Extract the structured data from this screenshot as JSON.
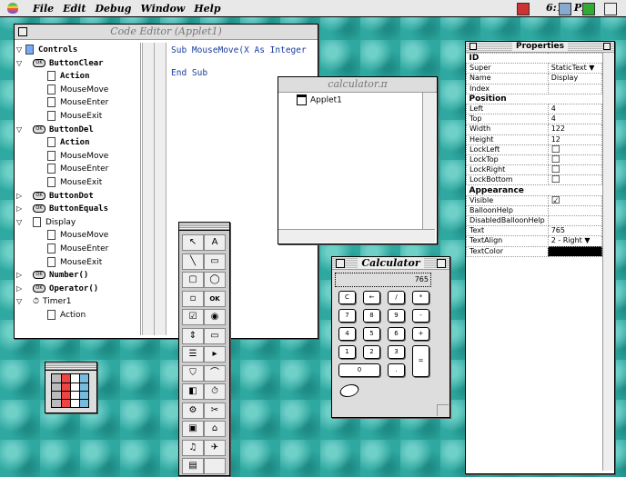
{
  "menubar": {
    "items": [
      "File",
      "Edit",
      "Debug",
      "Window",
      "Help"
    ],
    "clock": "6:15 PM"
  },
  "code_editor": {
    "title": "Code Editor (Applet1)",
    "code_lines": [
      "Sub MouseMove(X As Integer",
      "End Sub"
    ],
    "tree": [
      {
        "label": "Controls",
        "kind": "root",
        "expanded": true,
        "bold": true
      },
      {
        "label": "ButtonClear",
        "kind": "control",
        "expanded": true,
        "bold": true
      },
      {
        "label": "Action",
        "kind": "event",
        "bold": true
      },
      {
        "label": "MouseMove",
        "kind": "event"
      },
      {
        "label": "MouseEnter",
        "kind": "event"
      },
      {
        "label": "MouseExit",
        "kind": "event"
      },
      {
        "label": "ButtonDel",
        "kind": "control",
        "expanded": true,
        "bold": true
      },
      {
        "label": "Action",
        "kind": "event",
        "bold": true
      },
      {
        "label": "MouseMove",
        "kind": "event"
      },
      {
        "label": "MouseEnter",
        "kind": "event"
      },
      {
        "label": "MouseExit",
        "kind": "event"
      },
      {
        "label": "ButtonDot",
        "kind": "control",
        "expanded": false,
        "bold": true
      },
      {
        "label": "ButtonEquals",
        "kind": "control",
        "expanded": false,
        "bold": true
      },
      {
        "label": "Display",
        "kind": "control",
        "expanded": true
      },
      {
        "label": "MouseMove",
        "kind": "event"
      },
      {
        "label": "MouseEnter",
        "kind": "event"
      },
      {
        "label": "MouseExit",
        "kind": "event"
      },
      {
        "label": "Number()",
        "kind": "control",
        "expanded": false,
        "bold": true
      },
      {
        "label": "Operator()",
        "kind": "control",
        "expanded": false,
        "bold": true
      },
      {
        "label": "Timer1",
        "kind": "timer",
        "expanded": true
      },
      {
        "label": "Action",
        "kind": "event"
      }
    ]
  },
  "project": {
    "title": "calculator.π",
    "items": [
      "Applet1"
    ]
  },
  "properties": {
    "title": "Properties",
    "sections": [
      {
        "name": "ID",
        "rows": [
          [
            "Super",
            "StaticText"
          ],
          [
            "Name",
            "Display"
          ],
          [
            "Index",
            ""
          ]
        ]
      },
      {
        "name": "Position",
        "rows": [
          [
            "Left",
            "4"
          ],
          [
            "Top",
            "4"
          ],
          [
            "Width",
            "122"
          ],
          [
            "Height",
            "12"
          ],
          [
            "LockLeft",
            "☐"
          ],
          [
            "LockTop",
            "☐"
          ],
          [
            "LockRight",
            "☐"
          ],
          [
            "LockBottom",
            "☐"
          ]
        ]
      },
      {
        "name": "Appearance",
        "rows": [
          [
            "Visible",
            "☑"
          ],
          [
            "BalloonHelp",
            ""
          ],
          [
            "DisabledBalloonHelp",
            ""
          ],
          [
            "Text",
            "765"
          ],
          [
            "TextAlign",
            "2 - Right"
          ],
          [
            "TextColor",
            ""
          ]
        ]
      }
    ]
  },
  "calculator": {
    "title": "Calculator",
    "display": "765",
    "buttons": [
      [
        "C",
        "←",
        "/",
        "*"
      ],
      [
        "7",
        "8",
        "9",
        "-"
      ],
      [
        "4",
        "5",
        "6",
        "+"
      ],
      [
        "1",
        "2",
        "3",
        "="
      ],
      [
        "0",
        ".",
        "",
        ""
      ]
    ]
  },
  "colors": {
    "desktop": "#2ea8a0",
    "textcolor_swatch": "#000000"
  }
}
